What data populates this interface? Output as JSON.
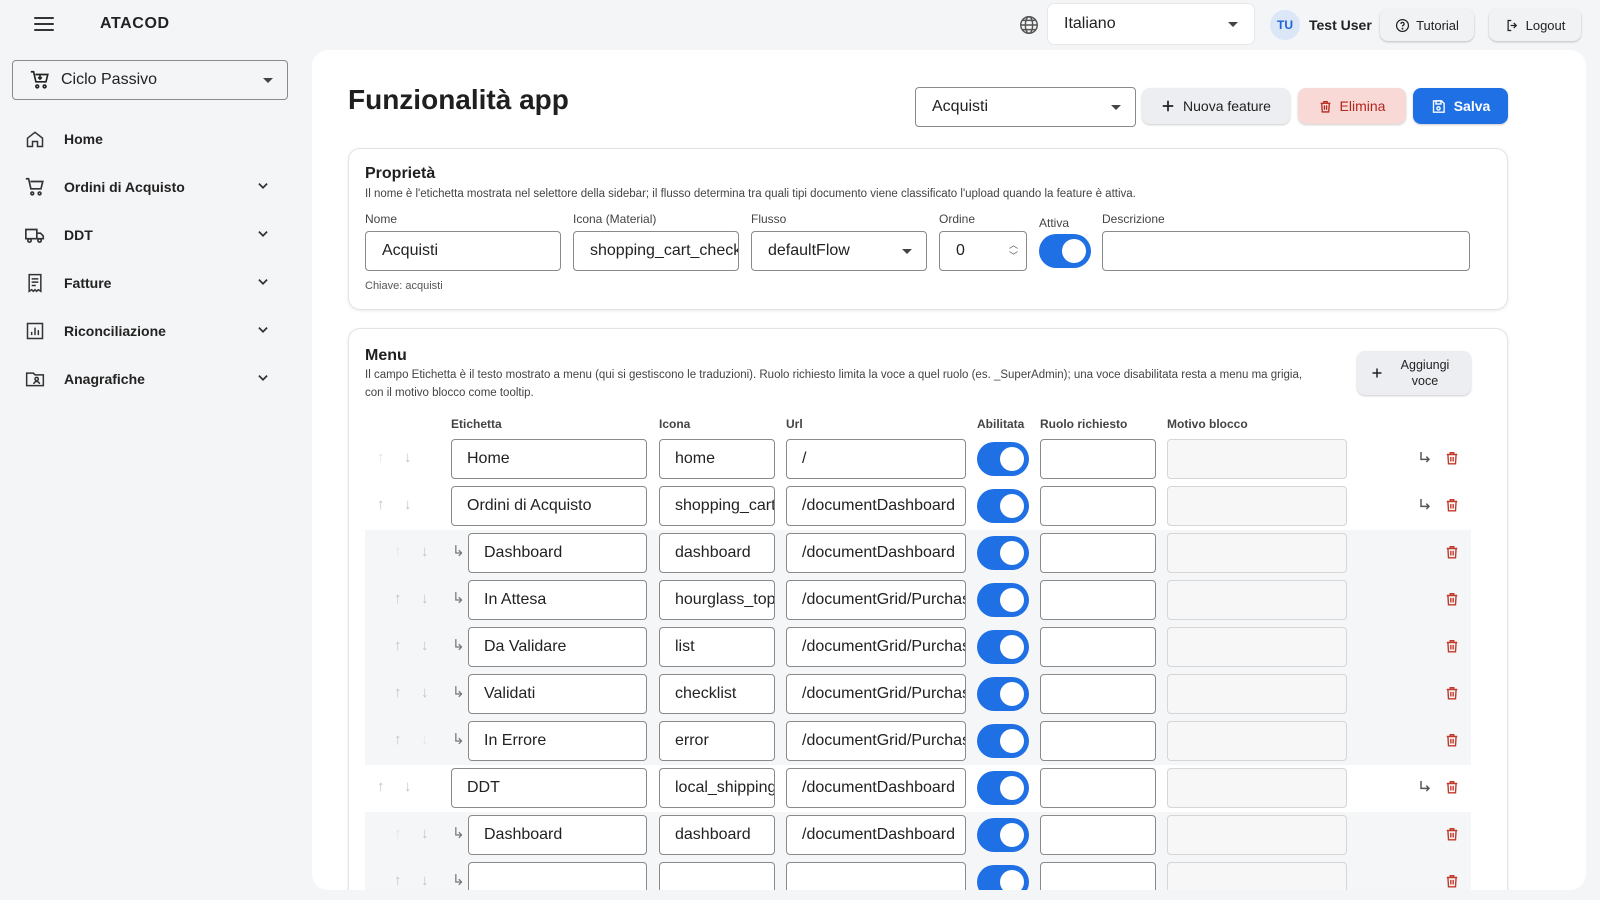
{
  "app": {
    "brand": "ATACOD"
  },
  "topbar": {
    "language": "Italiano",
    "user_initials": "TU",
    "user_name": "Test User",
    "tutorial_label": "Tutorial",
    "logout_label": "Logout"
  },
  "sidebar": {
    "module": "Ciclo Passivo",
    "items": [
      {
        "label": "Home",
        "icon": "home-icon"
      },
      {
        "label": "Ordini di Acquisto",
        "icon": "cart-icon"
      },
      {
        "label": "DDT",
        "icon": "truck-icon"
      },
      {
        "label": "Fatture",
        "icon": "receipt-icon"
      },
      {
        "label": "Riconciliazione",
        "icon": "chart-icon"
      },
      {
        "label": "Anagrafiche",
        "icon": "contact-folder-icon"
      }
    ]
  },
  "page": {
    "title": "Funzionalità app",
    "feature_select": "Acquisti",
    "new_feature_label": "Nuova feature",
    "delete_label": "Elimina",
    "save_label": "Salva"
  },
  "properties": {
    "title": "Proprietà",
    "description": "Il nome è l'etichetta mostrata nel selettore della sidebar; il flusso determina tra quali tipi documento viene classificato l'upload quando la feature è attiva.",
    "labels": {
      "name": "Nome",
      "icon": "Icona (Material)",
      "flow": "Flusso",
      "order": "Ordine",
      "active": "Attiva",
      "description": "Descrizione"
    },
    "values": {
      "name": "Acquisti",
      "icon": "shopping_cart_checkout",
      "flow": "defaultFlow",
      "order": "0",
      "description": ""
    },
    "active": true,
    "key_hint": "Chiave: acquisti"
  },
  "menu": {
    "title": "Menu",
    "description_line1": "Il campo Etichetta è il testo mostrato a menu (qui si gestiscono le traduzioni). Ruolo richiesto limita la voce a quel ruolo (es. _SuperAdmin); una voce disabilitata resta a menu ma grigia,",
    "description_line2": "con il motivo blocco come tooltip.",
    "add_label_line1": "Aggiungi",
    "add_label_line2": "voce",
    "columns": {
      "label": "Etichetta",
      "icon": "Icona",
      "url": "Url",
      "enabled": "Abilitata",
      "role": "Ruolo richiesto",
      "block_reason": "Motivo blocco"
    },
    "rows": [
      {
        "label": "Home",
        "icon": "home",
        "url": "/",
        "enabled": true,
        "role": "",
        "block": ""
      },
      {
        "label": "Ordini di Acquisto",
        "icon": "shopping_cart",
        "url": "/documentDashboard",
        "enabled": true,
        "role": "",
        "block": ""
      },
      {
        "label": "Dashboard",
        "icon": "dashboard",
        "url": "/documentDashboard",
        "enabled": true,
        "role": "",
        "block": ""
      },
      {
        "label": "In Attesa",
        "icon": "hourglass_top",
        "url": "/documentGrid/Purchase",
        "enabled": true,
        "role": "",
        "block": ""
      },
      {
        "label": "Da Validare",
        "icon": "list",
        "url": "/documentGrid/Purchase",
        "enabled": true,
        "role": "",
        "block": ""
      },
      {
        "label": "Validati",
        "icon": "checklist",
        "url": "/documentGrid/Purchase",
        "enabled": true,
        "role": "",
        "block": ""
      },
      {
        "label": "In Errore",
        "icon": "error",
        "url": "/documentGrid/Purchase",
        "enabled": true,
        "role": "",
        "block": ""
      },
      {
        "label": "DDT",
        "icon": "local_shipping",
        "url": "/documentDashboard",
        "enabled": true,
        "role": "",
        "block": ""
      },
      {
        "label": "Dashboard",
        "icon": "dashboard",
        "url": "/documentDashboard",
        "enabled": true,
        "role": "",
        "block": ""
      },
      {
        "label": "",
        "icon": "",
        "url": "",
        "enabled": true,
        "role": "",
        "block": ""
      }
    ]
  },
  "colors": {
    "accent": "#1f6fe5",
    "danger": "#b3261e",
    "danger_bg": "#f9d9d6"
  }
}
